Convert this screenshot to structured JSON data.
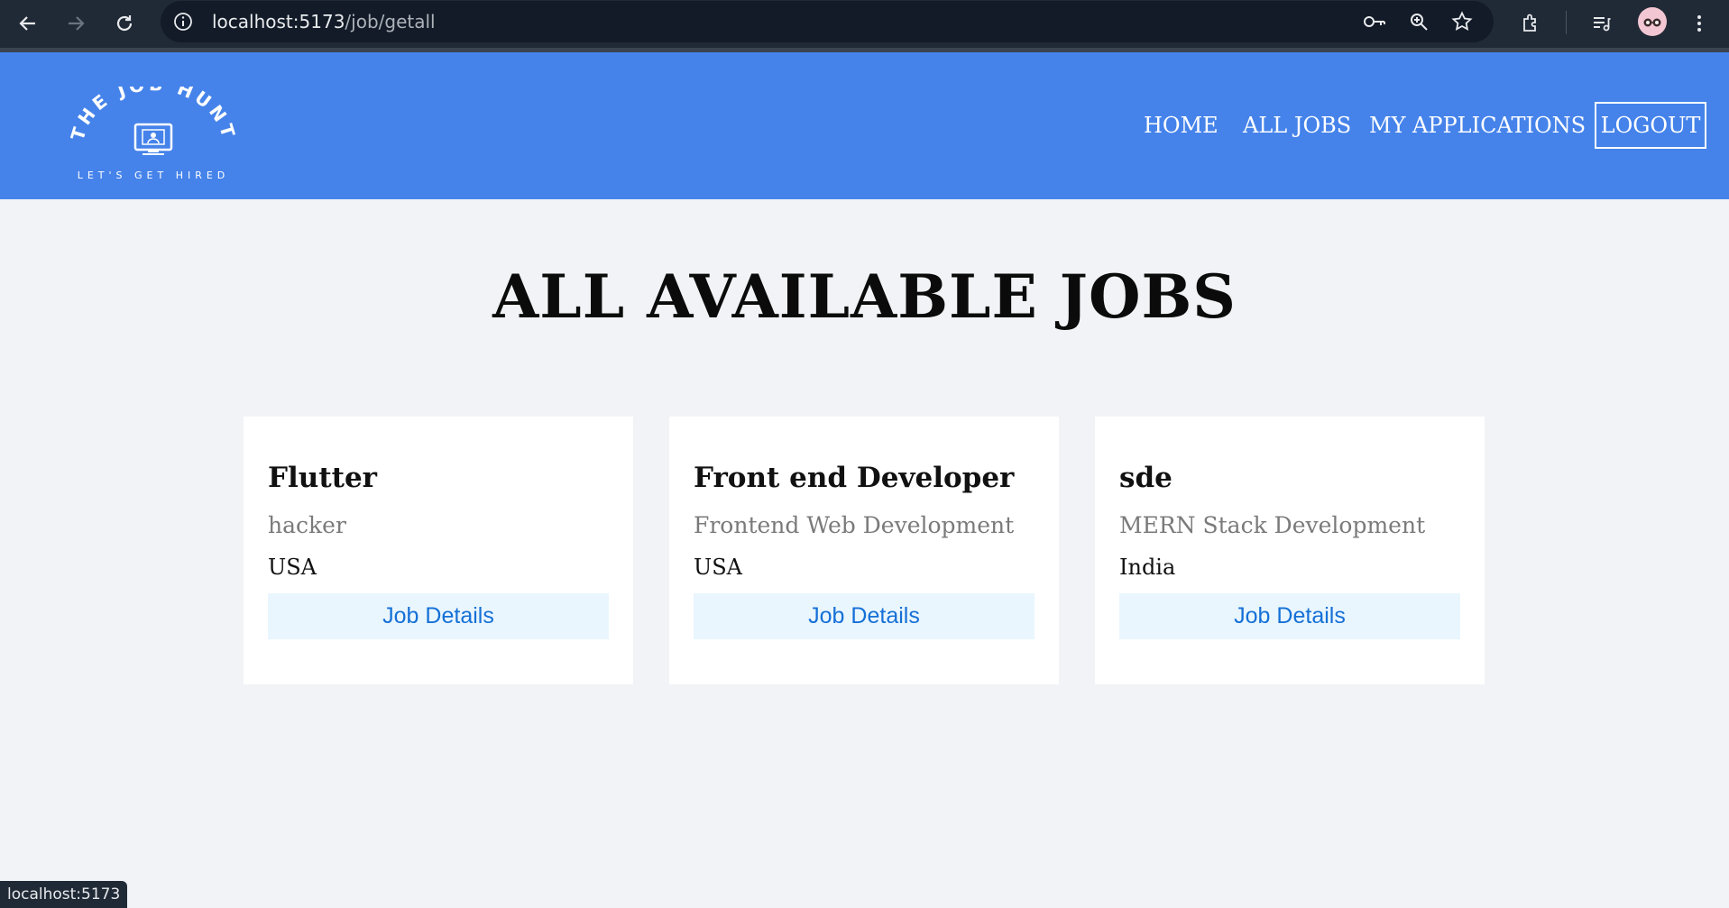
{
  "browser": {
    "url_host": "localhost:5173",
    "url_path": "/job/getall",
    "icons": [
      "back-arrow-icon",
      "forward-arrow-icon",
      "reload-icon",
      "site-info-icon",
      "password-key-icon",
      "zoom-icon",
      "bookmark-star-icon",
      "extensions-icon",
      "media-queue-icon",
      "profile-avatar-icon",
      "more-menu-icon"
    ],
    "status_link": "localhost:5173"
  },
  "site": {
    "logo_text": "THE JOB HUNT",
    "logo_tagline": "LET'S GET HIRED",
    "nav": {
      "home": "HOME",
      "all_jobs": "ALL JOBS",
      "my_applications": "MY APPLICATIONS",
      "logout": "LOGOUT"
    },
    "colors": {
      "header": "#4583ea",
      "button_bg": "#e9f6fe",
      "button_text": "#1570d6"
    }
  },
  "main": {
    "title": "ALL AVAILABLE JOBS",
    "jobs": [
      {
        "title": "Flutter",
        "company": "hacker",
        "location": "USA",
        "button": "Job Details"
      },
      {
        "title": "Front end Developer",
        "company": "Frontend Web Development",
        "location": "USA",
        "button": "Job Details"
      },
      {
        "title": "sde",
        "company": "MERN Stack Development",
        "location": "India",
        "button": "Job Details"
      }
    ]
  }
}
